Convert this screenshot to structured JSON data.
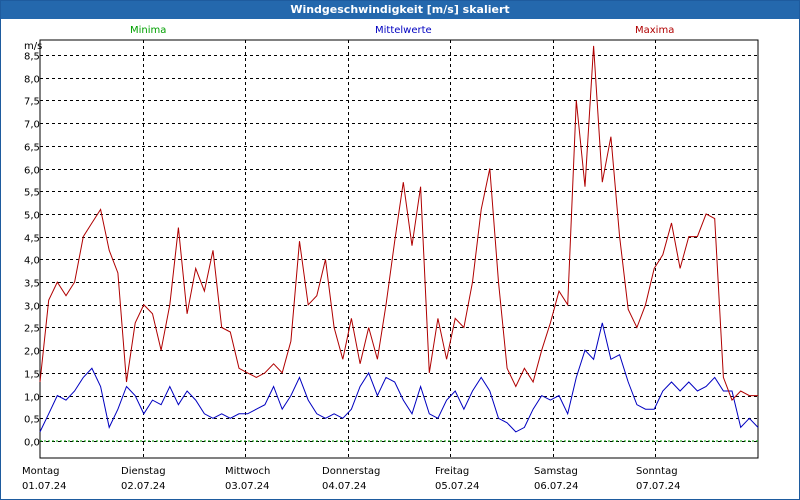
{
  "title": "Windgeschwindigkeit [m/s] skaliert",
  "colors": {
    "title_bg": "#2468ad",
    "min": "#00a000",
    "mean": "#0000c0",
    "max": "#b00000",
    "grid": "#000000"
  },
  "chart_data": {
    "type": "line",
    "title": "Windgeschwindigkeit [m/s] skaliert",
    "ylabel": "m/s",
    "ylim": [
      0,
      9
    ],
    "yticks": [
      "0,0",
      "0,5",
      "1,0",
      "1,5",
      "2,0",
      "2,5",
      "3,0",
      "3,5",
      "4,0",
      "4,5",
      "5,0",
      "5,5",
      "6,0",
      "6,5",
      "7,0",
      "7,5",
      "8,0",
      "8,5"
    ],
    "grid": true,
    "legend": [
      "Minima",
      "Mittelwerte",
      "Maxima"
    ],
    "days": [
      {
        "weekday": "Montag",
        "date": "01.07.24"
      },
      {
        "weekday": "Dienstag",
        "date": "02.07.24"
      },
      {
        "weekday": "Mittwoch",
        "date": "03.07.24"
      },
      {
        "weekday": "Donnerstag",
        "date": "04.07.24"
      },
      {
        "weekday": "Freitag",
        "date": "05.07.24"
      },
      {
        "weekday": "Samstag",
        "date": "06.07.24"
      },
      {
        "weekday": "Sonntag",
        "date": "07.07.24"
      }
    ],
    "series": [
      {
        "name": "Minima",
        "color": "#00a000",
        "values": [
          0.0,
          0.0,
          0.0,
          0.0,
          0.0,
          0.0,
          0.0,
          0.0,
          0.0,
          0.0,
          0.0,
          0.0,
          0.0,
          0.0,
          0.0,
          0.0,
          0.0,
          0.0,
          0.0,
          0.0,
          0.0,
          0.0,
          0.0,
          0.0,
          0.0,
          0.0,
          0.0,
          0.0,
          0.0,
          0.0,
          0.0,
          0.0,
          0.0,
          0.0,
          0.0,
          0.0,
          0.0,
          0.0,
          0.0,
          0.0,
          0.0,
          0.0,
          0.0,
          0.0,
          0.0,
          0.0,
          0.0,
          0.0,
          0.0,
          0.0,
          0.0,
          0.0,
          0.0,
          0.0,
          0.0,
          0.0,
          0.0,
          0.0,
          0.0,
          0.0,
          0.0,
          0.0,
          0.0,
          0.0,
          0.0,
          0.0,
          0.0,
          0.0,
          0.0,
          0.0,
          0.0,
          0.0,
          0.0,
          0.0,
          0.0,
          0.0,
          0.0,
          0.0,
          0.0,
          0.0,
          0.0,
          0.0,
          0.0,
          0.0
        ]
      },
      {
        "name": "Mittelwerte",
        "color": "#0000c0",
        "values": [
          0.2,
          0.6,
          1.0,
          0.9,
          1.1,
          1.4,
          1.6,
          1.2,
          0.3,
          0.7,
          1.2,
          1.0,
          0.6,
          0.9,
          0.8,
          1.2,
          0.8,
          1.1,
          0.9,
          0.6,
          0.5,
          0.6,
          0.5,
          0.6,
          0.6,
          0.7,
          0.8,
          1.2,
          0.7,
          1.0,
          1.4,
          0.9,
          0.6,
          0.5,
          0.6,
          0.5,
          0.7,
          1.2,
          1.5,
          1.0,
          1.4,
          1.3,
          0.9,
          0.6,
          1.2,
          0.6,
          0.5,
          0.9,
          1.1,
          0.7,
          1.1,
          1.4,
          1.1,
          0.5,
          0.4,
          0.2,
          0.3,
          0.7,
          1.0,
          0.9,
          1.0,
          0.6,
          1.4,
          2.0,
          1.8,
          2.6,
          1.8,
          1.9,
          1.3,
          0.8,
          0.7,
          0.7,
          1.1,
          1.3,
          1.1,
          1.3,
          1.1,
          1.2,
          1.4,
          1.1,
          1.1,
          0.3,
          0.5,
          0.3
        ]
      },
      {
        "name": "Maxima",
        "color": "#b00000",
        "values": [
          1.3,
          3.1,
          3.5,
          3.2,
          3.5,
          4.5,
          4.8,
          5.1,
          4.2,
          3.7,
          1.3,
          2.6,
          3.0,
          2.8,
          2.0,
          3.0,
          4.7,
          2.8,
          3.8,
          3.3,
          4.2,
          2.5,
          2.4,
          1.6,
          1.5,
          1.4,
          1.5,
          1.7,
          1.5,
          2.2,
          4.4,
          3.0,
          3.2,
          4.0,
          2.5,
          1.8,
          2.7,
          1.7,
          2.5,
          1.8,
          3.0,
          4.4,
          5.7,
          4.3,
          5.6,
          1.5,
          2.7,
          1.8,
          2.7,
          2.5,
          3.5,
          5.1,
          6.0,
          3.5,
          1.6,
          1.2,
          1.6,
          1.3,
          2.0,
          2.6,
          3.3,
          3.0,
          7.5,
          5.6,
          8.7,
          5.7,
          6.7,
          4.5,
          2.9,
          2.5,
          3.0,
          3.8,
          4.1,
          4.8,
          3.8,
          4.5,
          4.5,
          5.0,
          4.9,
          1.4,
          0.9,
          1.1,
          1.0,
          1.0
        ]
      }
    ]
  }
}
